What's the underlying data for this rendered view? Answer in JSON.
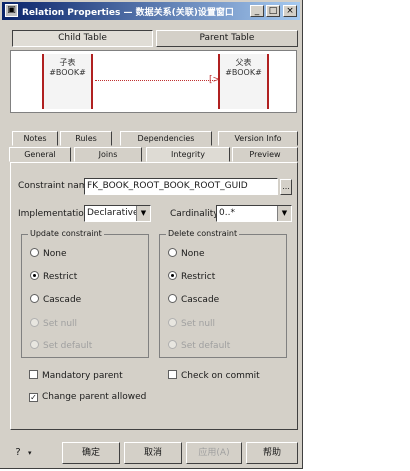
{
  "window": {
    "icon_glyph": "▣",
    "title": "Relation Properties — 数据关系(关联)设置窗口",
    "min_glyph": "_",
    "max_glyph": "□",
    "close_glyph": "×"
  },
  "top_buttons": [
    {
      "label": "Child Table"
    },
    {
      "label": "Parent Table"
    }
  ],
  "diagram": {
    "left_table": {
      "line1": "子表",
      "line2": "#BOOK#"
    },
    "right_table": {
      "line1": "父表",
      "line2": "#BOOK#"
    },
    "connector_end": "[>"
  },
  "tabs_row1": [
    {
      "label": "Notes"
    },
    {
      "label": "Rules"
    },
    {
      "label": "Dependencies"
    },
    {
      "label": "Version Info"
    }
  ],
  "tabs_row2": [
    {
      "label": "General"
    },
    {
      "label": "Joins"
    },
    {
      "label": "Integrity"
    },
    {
      "label": "Preview"
    }
  ],
  "form": {
    "constraint_label": "Constraint name:",
    "constraint_value": "FK_BOOK_ROOT_BOOK_ROOT_GUID",
    "ellipsis": "...",
    "implementation_label": "Implementation:",
    "implementation_value": "Declarative",
    "cardinality_label": "Cardinality:",
    "cardinality_value": "0..*"
  },
  "update_group": {
    "title": "Update constraint",
    "options": [
      "None",
      "Restrict",
      "Cascade",
      "Set null",
      "Set default"
    ]
  },
  "delete_group": {
    "title": "Delete constraint",
    "options": [
      "None",
      "Restrict",
      "Cascade",
      "Set null",
      "Set default"
    ]
  },
  "checks": {
    "mandatory_parent": "Mandatory parent",
    "check_on_commit": "Check on commit",
    "change_parent_allowed": "Change parent allowed",
    "check_glyph": "✓"
  },
  "bottom": {
    "help_icon_glyph": "?",
    "help_dropdown_glyph": "▾",
    "ok": "确定",
    "cancel": "取消",
    "apply": "应用(A)",
    "help": "帮助"
  }
}
